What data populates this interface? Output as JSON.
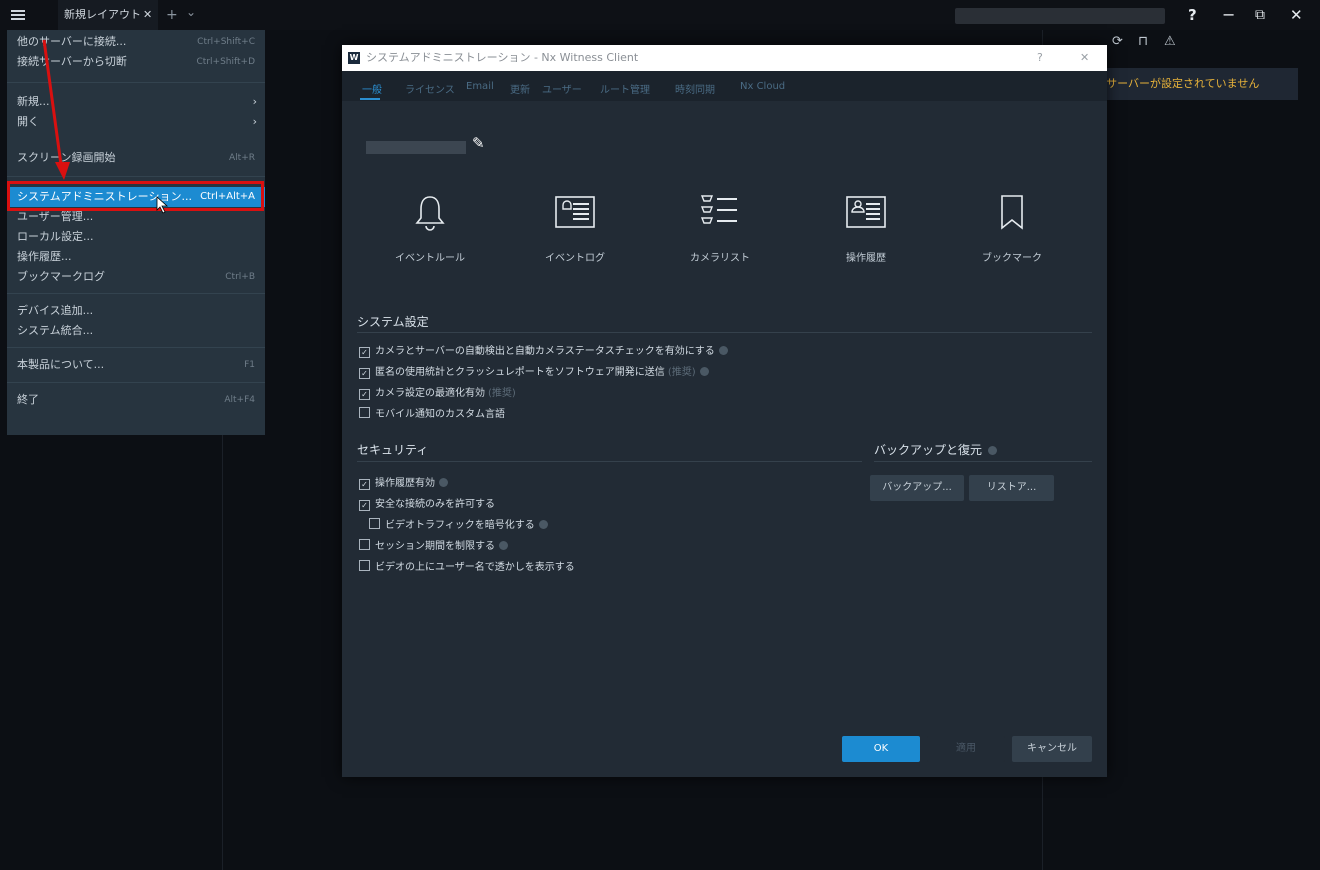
{
  "window": {
    "tab_label": "新規レイアウト",
    "tab_close": "✕",
    "add_tab": "+",
    "tab_dropdown": "⌄",
    "help": "?",
    "minimize": "−",
    "restore": "⧉",
    "close": "✕"
  },
  "notification": {
    "text": "ilサーバーが設定されていません"
  },
  "menu": {
    "items": [
      {
        "label": "他のサーバーに接続...",
        "shortcut": "Ctrl+Shift+C"
      },
      {
        "label": "接続サーバーから切断",
        "shortcut": "Ctrl+Shift+D"
      },
      {
        "label": "新規...",
        "shortcut": "›"
      },
      {
        "label": "開く",
        "shortcut": "›"
      },
      {
        "label": "スクリーン録画開始",
        "shortcut": "Alt+R"
      },
      {
        "label": "システムアドミニストレーション...",
        "shortcut": "Ctrl+Alt+A"
      },
      {
        "label": "ユーザー管理...",
        "shortcut": ""
      },
      {
        "label": "ローカル設定...",
        "shortcut": ""
      },
      {
        "label": "操作履歴...",
        "shortcut": ""
      },
      {
        "label": "ブックマークログ",
        "shortcut": "Ctrl+B"
      },
      {
        "label": "デバイス追加...",
        "shortcut": ""
      },
      {
        "label": "システム統合...",
        "shortcut": ""
      },
      {
        "label": "本製品について...",
        "shortcut": "F1"
      },
      {
        "label": "終了",
        "shortcut": "Alt+F4"
      }
    ]
  },
  "dialog": {
    "logo": "W",
    "title": "システムアドミニストレーション - Nx Witness Client",
    "help": "?",
    "close": "✕",
    "tabs": [
      "一般",
      "ライセンス",
      "Email",
      "更新",
      "ユーザー",
      "ルート管理",
      "時刻同期",
      "Nx Cloud"
    ],
    "tiles": [
      {
        "label": "イベントルール",
        "icon": "bell-icon"
      },
      {
        "label": "イベントログ",
        "icon": "event-log-icon"
      },
      {
        "label": "カメラリスト",
        "icon": "camera-list-icon"
      },
      {
        "label": "操作履歴",
        "icon": "audit-trail-icon"
      },
      {
        "label": "ブックマーク",
        "icon": "bookmark-icon"
      }
    ],
    "system_settings": {
      "heading": "システム設定",
      "options": [
        {
          "label": "カメラとサーバーの自動検出と自動カメラステータスチェックを有効にする",
          "checked": true,
          "hint": ""
        },
        {
          "label": "匿名の使用統計とクラッシュレポートをソフトウェア開発に送信",
          "checked": true,
          "hint": "(推奨)"
        },
        {
          "label": "カメラ設定の最適化有効",
          "checked": true,
          "hint": "(推奨)"
        },
        {
          "label": "モバイル通知のカスタム言語",
          "checked": false,
          "hint": ""
        }
      ]
    },
    "security": {
      "heading": "セキュリティ",
      "options": [
        {
          "label": "操作履歴有効",
          "checked": true
        },
        {
          "label": "安全な接続のみを許可する",
          "checked": true
        },
        {
          "label": "ビデオトラフィックを暗号化する",
          "checked": false
        },
        {
          "label": "セッション期間を制限する",
          "checked": false
        },
        {
          "label": "ビデオの上にユーザー名で透かしを表示する",
          "checked": false
        }
      ]
    },
    "backup": {
      "heading": "バックアップと復元",
      "backup_button": "バックアップ...",
      "restore_button": "リストア..."
    },
    "buttons": {
      "ok": "OK",
      "apply": "適用",
      "cancel": "キャンセル"
    }
  },
  "colors": {
    "accent": "#1c8bd1",
    "highlight": "#d91010",
    "warning": "#e7b23a"
  }
}
